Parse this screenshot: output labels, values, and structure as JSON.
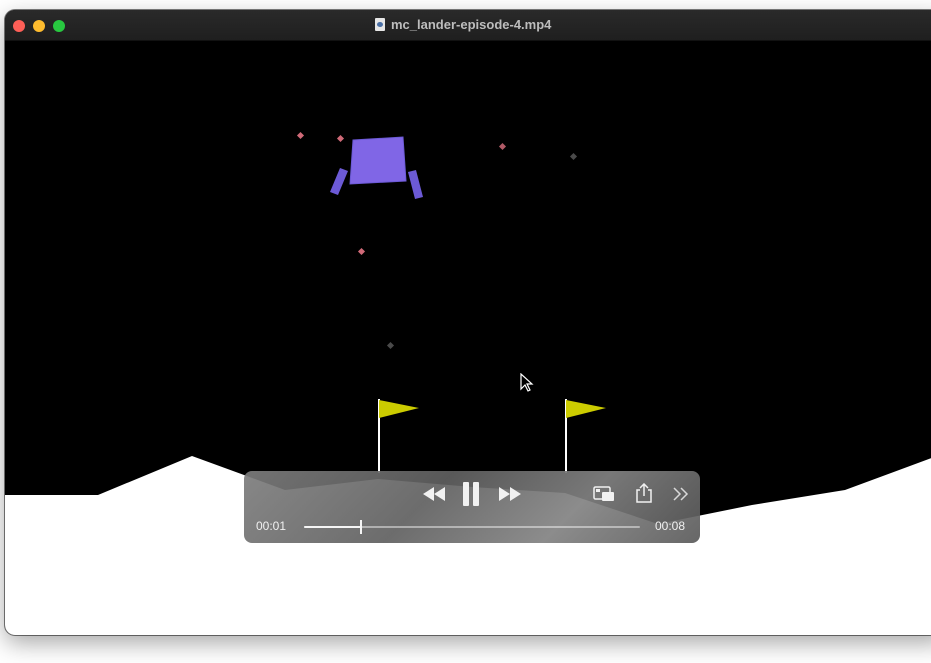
{
  "window": {
    "title": "mc_lander-episode-4.mp4"
  },
  "player": {
    "current_time": "00:01",
    "total_time": "00:08",
    "progress": 0.17,
    "state": "playing"
  },
  "icons": {
    "file": "video-file-icon",
    "rewind": "rewind-icon",
    "pause": "pause-icon",
    "fast_forward": "fast-forward-icon",
    "picture_in_picture": "picture-in-picture-icon",
    "share": "share-icon",
    "more": "chevron-double-right-icon"
  },
  "colors": {
    "sky": "#000000",
    "ground": "#ffffff",
    "lander": "#8066e6",
    "lander_legs": "#6c5ad6",
    "flag": "#cccc00",
    "particles": "#d06a78"
  }
}
